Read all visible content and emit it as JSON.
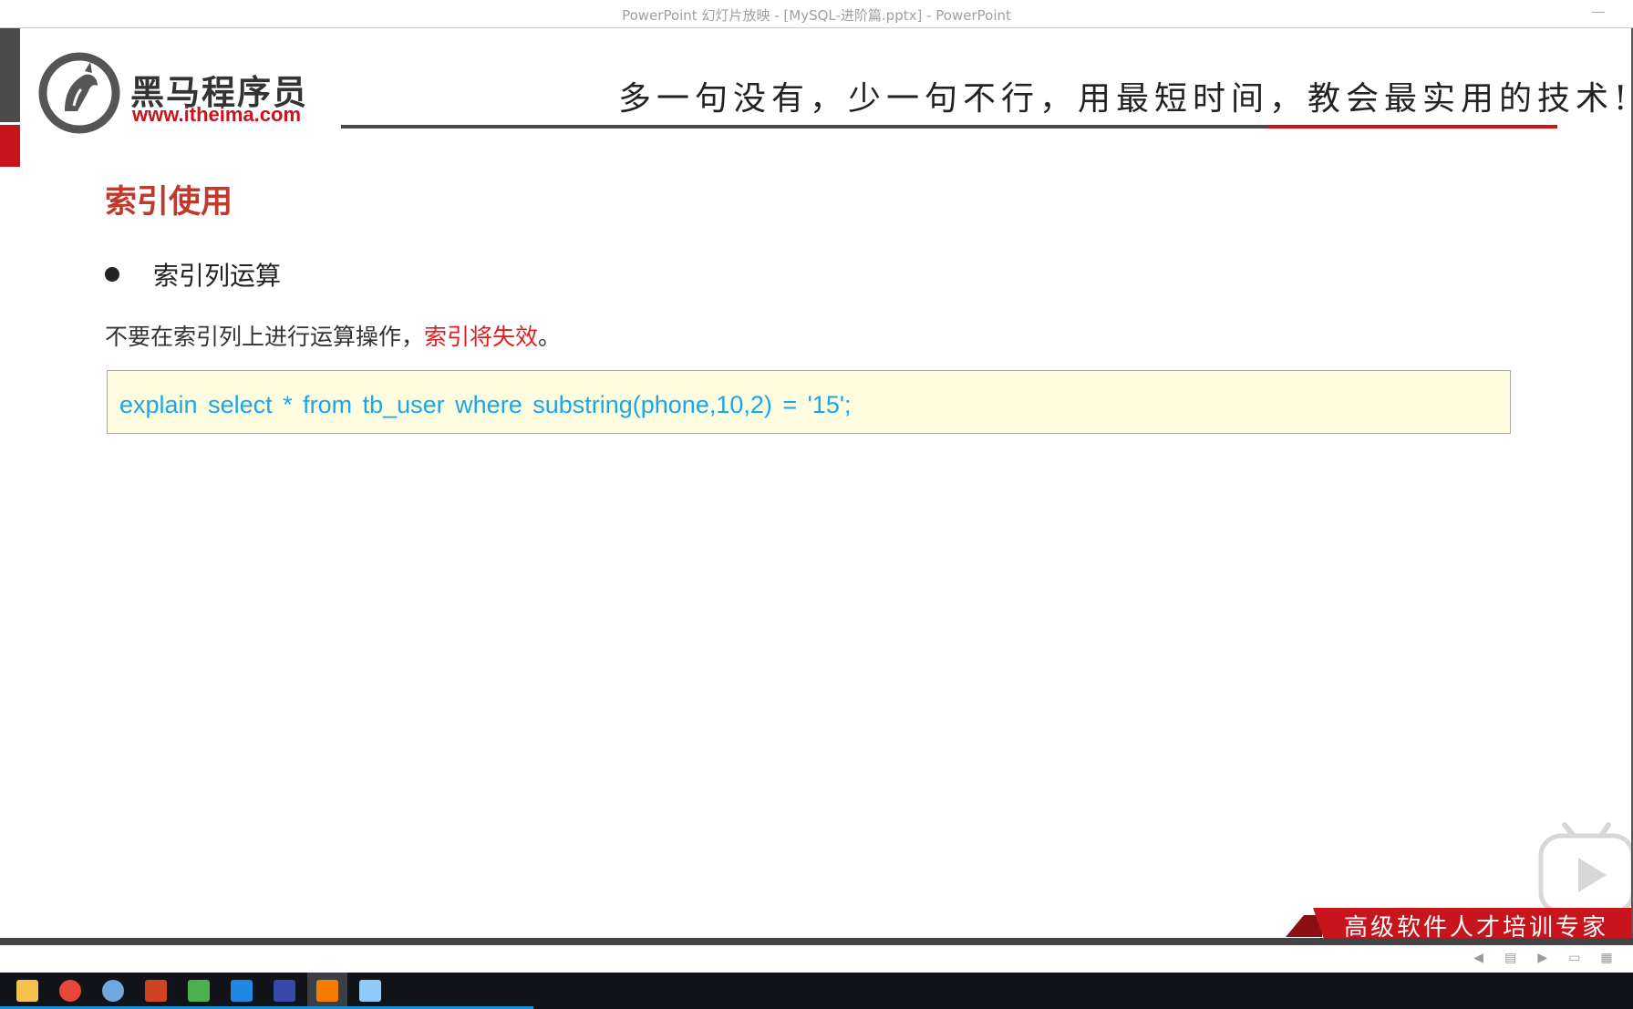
{
  "window": {
    "title": "PowerPoint 幻灯片放映 - [MySQL-进阶篇.pptx] - PowerPoint",
    "minimize_glyph": "—"
  },
  "brand": {
    "name_cn": "黑马程序员",
    "url": "www.itheima.com",
    "slogan": "多一句没有，少一句不行，用最短时间，教会最实用的技术!",
    "footer_slogan": "高级软件人才培训专家",
    "watermark": "黑马程序员",
    "red": "#c8141c",
    "gray": "#4b4b4b"
  },
  "slide": {
    "heading": "索引使用",
    "bullet": "索引列运算",
    "body_prefix": "不要在索引列上进行运算操作，",
    "body_highlight": "索引将失效",
    "body_suffix": "。",
    "code": "explain select * from tb_user where substring(phone,10,2) = '15';",
    "code_color": "#1ba6e8",
    "code_bg": "#fffde0"
  },
  "overlay": {
    "icon": "play-icon"
  },
  "slideshow_controls": [
    {
      "icon": "previous-slide-icon",
      "glyph": "◀"
    },
    {
      "icon": "notes-icon",
      "glyph": "▤"
    },
    {
      "icon": "next-slide-icon",
      "glyph": "▶"
    },
    {
      "icon": "normal-view-icon",
      "glyph": "▭"
    },
    {
      "icon": "slide-sorter-icon",
      "glyph": "▦"
    }
  ],
  "taskbar": {
    "apps": [
      {
        "icon": "file-explorer-icon",
        "color": "#f2c14e"
      },
      {
        "icon": "chrome-icon",
        "color": "#e9473a"
      },
      {
        "icon": "app-icon",
        "color": "#6fa8dc"
      },
      {
        "icon": "powerpoint-icon",
        "color": "#d04423"
      },
      {
        "icon": "notepad-icon",
        "color": "#4caf50"
      },
      {
        "icon": "sync-icon",
        "color": "#1e88e5"
      },
      {
        "icon": "datagrip-icon",
        "color": "#3949ab"
      },
      {
        "icon": "pdf-icon",
        "color": "#f57c00"
      },
      {
        "icon": "remote-desktop-icon",
        "color": "#90caf9"
      }
    ]
  }
}
